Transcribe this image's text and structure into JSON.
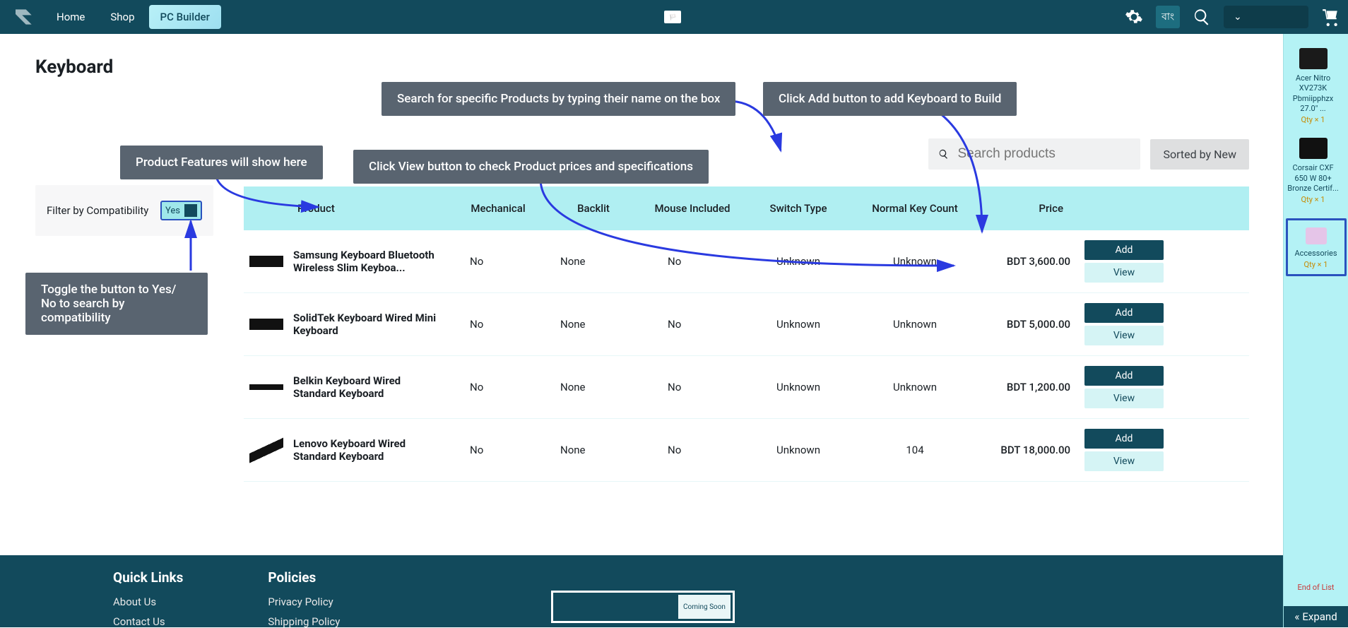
{
  "nav": {
    "links": [
      {
        "label": "Home",
        "active": false
      },
      {
        "label": "Shop",
        "active": false
      },
      {
        "label": "PC Builder",
        "active": true
      }
    ],
    "language_badge": "বাং"
  },
  "page": {
    "title": "Keyboard"
  },
  "tips": {
    "search": "Search for specific Products by typing their name on the box",
    "add": "Click Add button to add Keyboard to Build",
    "features": "Product Features will show here",
    "view": "Click View button to check Product prices and specifications",
    "toggle": "Toggle the button to Yes/ No to search by compatibility"
  },
  "filter": {
    "label": "Filter by Compatibility",
    "value": "Yes"
  },
  "search": {
    "placeholder": "Search products"
  },
  "sort": {
    "label": "Sorted by New"
  },
  "table": {
    "columns": [
      "",
      "Product",
      "Mechanical",
      "Backlit",
      "Mouse Included",
      "Switch Type",
      "Normal Key Count",
      "Price",
      ""
    ],
    "add_label": "Add",
    "view_label": "View",
    "rows": [
      {
        "name": "Samsung Keyboard Bluetooth Wireless Slim Keyboa...",
        "mechanical": "No",
        "backlit": "None",
        "mouse": "No",
        "switch": "Unknown",
        "keys": "Unknown",
        "price": "BDT 3,600.00",
        "imgclass": ""
      },
      {
        "name": "SolidTek Keyboard Wired Mini Keyboard",
        "mechanical": "No",
        "backlit": "None",
        "mouse": "No",
        "switch": "Unknown",
        "keys": "Unknown",
        "price": "BDT 5,000.00",
        "imgclass": ""
      },
      {
        "name": "Belkin Keyboard Wired Standard Keyboard",
        "mechanical": "No",
        "backlit": "None",
        "mouse": "No",
        "switch": "Unknown",
        "keys": "Unknown",
        "price": "BDT 1,200.00",
        "imgclass": "flat"
      },
      {
        "name": "Lenovo Keyboard Wired Standard Keyboard",
        "mechanical": "No",
        "backlit": "None",
        "mouse": "No",
        "switch": "Unknown",
        "keys": "104",
        "price": "BDT 18,000.00",
        "imgclass": "tilt"
      }
    ]
  },
  "build_rail": {
    "items": [
      {
        "title": "Acer Nitro XV273K Pbmiipphzx 27.0\" ...",
        "qty": "Qty × 1",
        "highlight": false,
        "thumb_color": "#1a1a1a"
      },
      {
        "title": "Corsair CXF 650 W 80+ Bronze Certif...",
        "qty": "Qty × 1",
        "highlight": false,
        "thumb_color": "#111"
      },
      {
        "title": "Accessories",
        "qty": "Qty × 1",
        "highlight": true,
        "thumb_color": "#e5c5e8"
      }
    ],
    "end_text": "End of List",
    "expand_label": "Expand"
  },
  "footer": {
    "quick_links": {
      "heading": "Quick Links",
      "links": [
        "About Us",
        "Contact Us"
      ]
    },
    "policies": {
      "heading": "Policies",
      "links": [
        "Privacy Policy",
        "Shipping Policy"
      ]
    },
    "newsletter_btn": "Coming Soon"
  }
}
